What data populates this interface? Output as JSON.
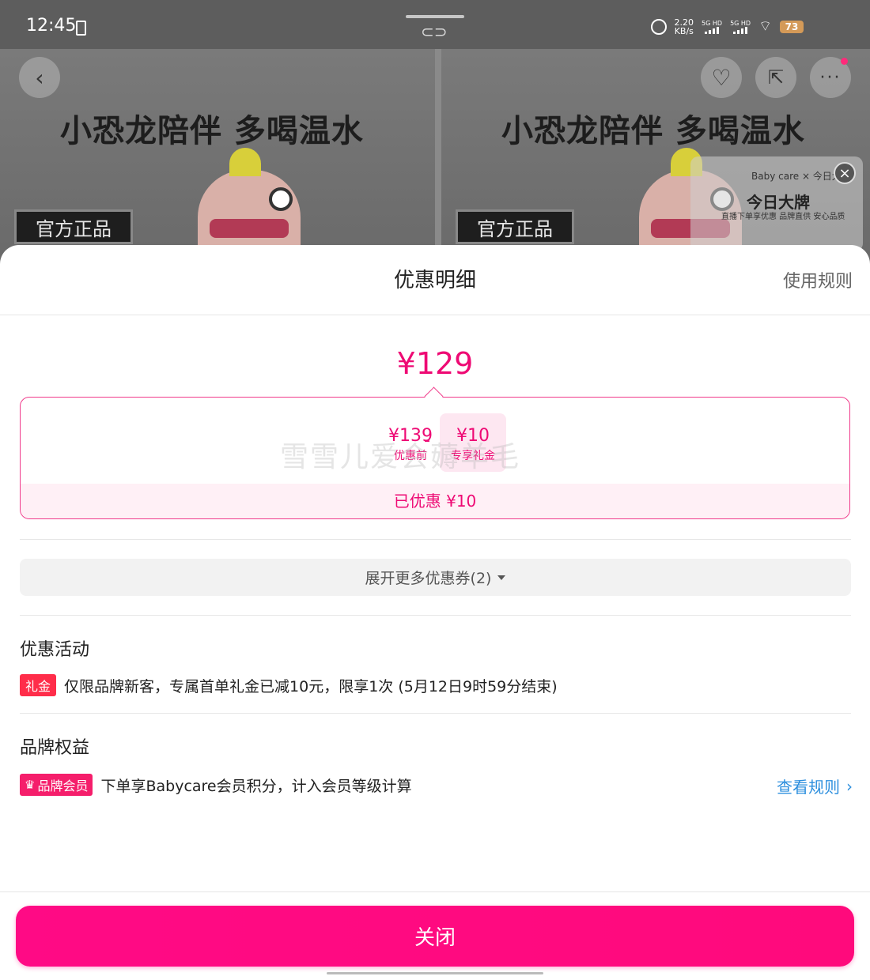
{
  "status_bar": {
    "time": "12:45",
    "net_speed": "2.20",
    "net_unit": "KB/s",
    "sim1": "5G HD",
    "sim2": "5G HD",
    "battery": "73"
  },
  "background": {
    "slogan": "小恐龙陪伴 多喝温水",
    "tag": "官方正品",
    "ad": {
      "brand": "Baby care × 今日大牌",
      "title": "今日大牌",
      "subtitle": "直播下单享优惠  品牌直供 安心品质"
    }
  },
  "sheet": {
    "title": "优惠明细",
    "rules_link": "使用规则",
    "final_price": "¥129",
    "breakdown": {
      "before_amount": "¥139",
      "before_label": "优惠前",
      "operator": "-",
      "gift_amount": "¥10",
      "gift_label": "专享礼金",
      "watermark": "雪雪儿爱会薅羊毛",
      "saved_text": "已优惠 ¥10"
    },
    "expand_button": "展开更多优惠券(2)",
    "promotions": {
      "title": "优惠活动",
      "tag": "礼金",
      "text": "仅限品牌新客，专属首单礼金已减10元，限享1次 (5月12日9时59分结束)"
    },
    "brand_benefits": {
      "title": "品牌权益",
      "tag": "品牌会员",
      "text": "下单享Babycare会员积分，计入会员等级计算",
      "link": "查看规则"
    },
    "close_button": "关闭"
  },
  "colors": {
    "accent": "#ff0a85",
    "price": "#ee0a74",
    "link": "#2d8fde"
  }
}
